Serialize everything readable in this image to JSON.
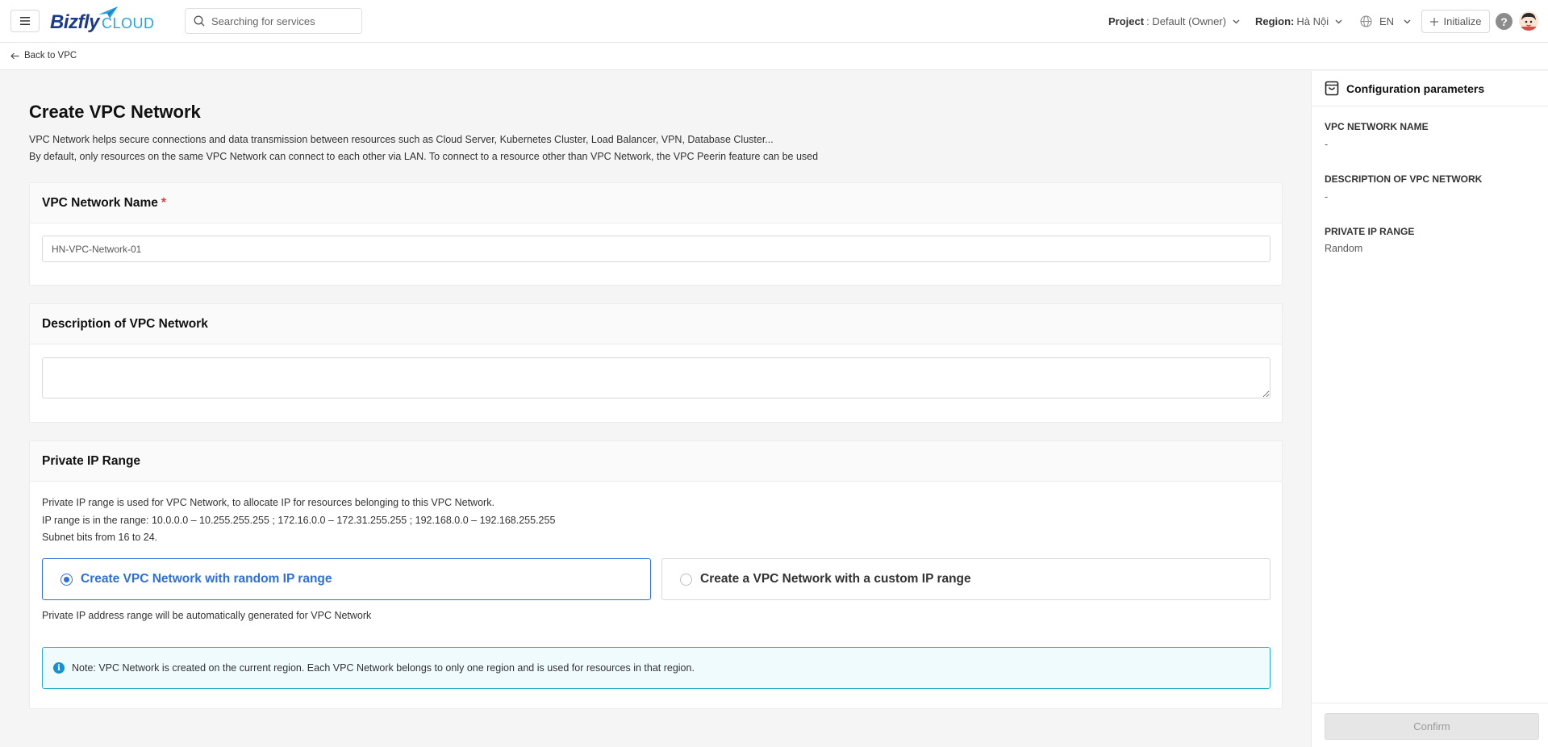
{
  "header": {
    "logo_brand": "Bizfly",
    "logo_suffix": "CLOUD",
    "search_placeholder": "Searching for services",
    "project_label": "Project",
    "project_value": ": Default (Owner)",
    "region_label": "Region:",
    "region_value": "Hà Nội",
    "language": "EN",
    "initialize_label": "Initialize",
    "help_glyph": "?"
  },
  "breadcrumb": {
    "back_label": "Back to VPC"
  },
  "page": {
    "title": "Create VPC Network",
    "intro_line1": "VPC Network helps secure connections and data transmission between resources such as Cloud Server, Kubernetes Cluster, Load Balancer, VPN, Database Cluster...",
    "intro_line2": "By default, only resources on the same VPC Network can connect to each other via LAN. To connect to a resource other than VPC Network, the VPC Peerin feature can be used"
  },
  "name_card": {
    "title": "VPC Network Name",
    "required_mark": "*",
    "input_value": "HN-VPC-Network-01"
  },
  "description_card": {
    "title": "Description of VPC Network",
    "textarea_value": ""
  },
  "ip_card": {
    "title": "Private IP Range",
    "desc_line1": "Private IP range is used for VPC Network, to allocate IP for resources belonging to this VPC Network.",
    "desc_line2": "IP range is in the range: 10.0.0.0 – 10.255.255.255 ; 172.16.0.0 – 172.31.255.255 ; 192.168.0.0 – 192.168.255.255",
    "desc_line3": "Subnet bits from 16 to 24.",
    "option_random": "Create VPC Network with random IP range",
    "option_custom": "Create a VPC Network with a custom IP range",
    "selected_option": "random",
    "auto_note": "Private IP address range will be automatically generated for VPC Network",
    "info_glyph": "i",
    "region_note": "Note: VPC Network is created on the current region. Each VPC Network belongs to only one region and is used for resources in that region."
  },
  "config_panel": {
    "title": "Configuration parameters",
    "name_label": "VPC NETWORK NAME",
    "name_value": "-",
    "desc_label": "DESCRIPTION OF VPC NETWORK",
    "desc_value": "-",
    "ip_label": "PRIVATE IP RANGE",
    "ip_value": "Random",
    "confirm_label": "Confirm"
  },
  "colors": {
    "accent": "#2f6fdc",
    "brand_dark": "#1a3a8f",
    "brand_light": "#29a3e0",
    "required": "#e53935",
    "info_border": "#2bb0c9"
  }
}
